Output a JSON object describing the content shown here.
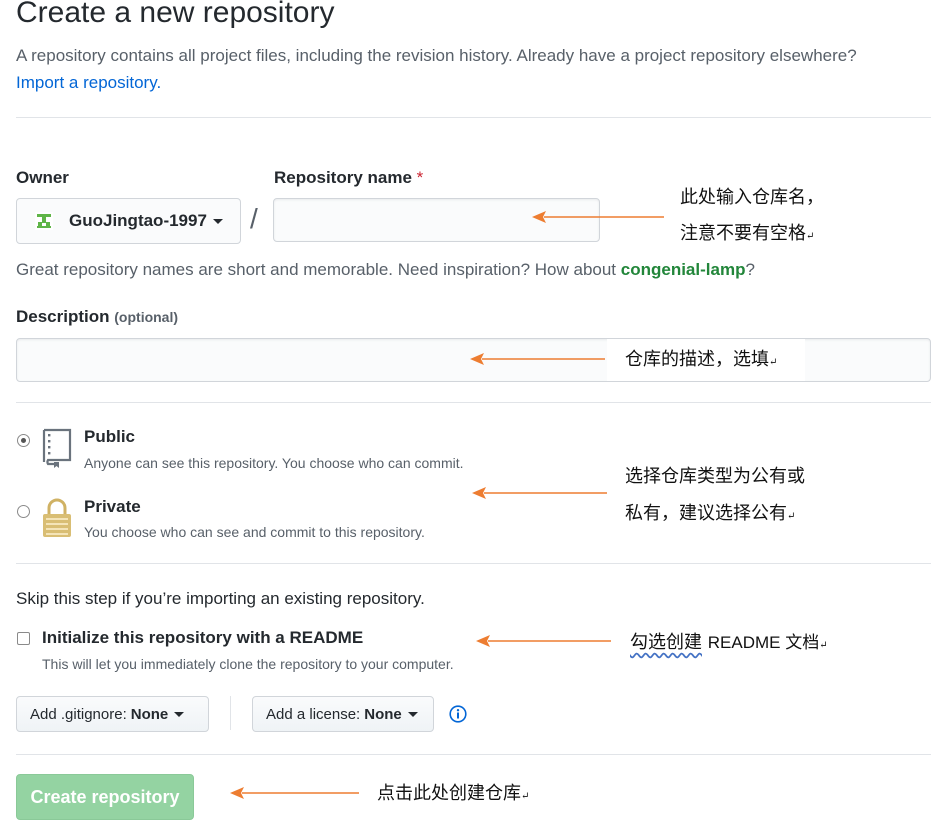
{
  "page": {
    "title": "Create a new repository",
    "lead": "A repository contains all project files, including the revision history. Already have a project repository elsewhere?",
    "import_link": "Import a repository."
  },
  "owner": {
    "label": "Owner",
    "value": "GuoJingtao-1997"
  },
  "repo_name": {
    "label": "Repository name",
    "required_mark": "*",
    "value": "",
    "separator": "/"
  },
  "hint": {
    "text": "Great repository names are short and memorable. Need inspiration? How about",
    "suggestion": "congenial-lamp",
    "end": "?"
  },
  "description": {
    "label": "Description",
    "optional": "(optional)",
    "value": ""
  },
  "visibility": {
    "public": {
      "title": "Public",
      "desc": "Anyone can see this repository. You choose who can commit.",
      "selected": true
    },
    "private": {
      "title": "Private",
      "desc": "You choose who can see and commit to this repository.",
      "selected": false
    }
  },
  "init": {
    "skip_text": "Skip this step if you’re importing an existing repository.",
    "readme_label": "Initialize this repository with a README",
    "readme_desc": "This will let you immediately clone the repository to your computer.",
    "readme_checked": false
  },
  "gitignore": {
    "prefix": "Add .gitignore:",
    "value": "None"
  },
  "license": {
    "prefix": "Add a license:",
    "value": "None"
  },
  "create_button": "Create repository",
  "annotations": {
    "repo_name_line1": "此处输入仓库名，",
    "repo_name_line2": "注意不要有空格",
    "description": "仓库的描述，选填",
    "visibility_line1": "选择仓库类型为公有或",
    "visibility_line2": "私有，建议选择公有",
    "readme_underlined": "勾选创建",
    "readme_rest": "README 文档",
    "create": "点击此处创建仓库",
    "paragraph_mark": "↵"
  },
  "colors": {
    "link": "#0366d6",
    "suggestion": "#22863a",
    "required": "#cb2431",
    "create_button_disabled": "#94d3a2",
    "annotation_arrow": "#ed7d31",
    "info_icon": "#0366d6"
  }
}
